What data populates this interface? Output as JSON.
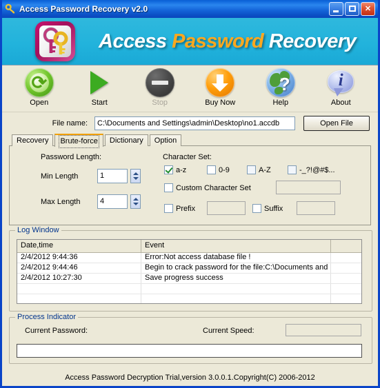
{
  "window": {
    "title": "Access Password Recovery v2.0",
    "icon": "key-icon",
    "controls": {
      "minimize": "minimize-button",
      "maximize": "maximize-button",
      "close": "close-button",
      "close_glyph": "✕"
    }
  },
  "banner": {
    "logo": "app-logo-key",
    "title_part1": "Access ",
    "title_part2": "Password ",
    "title_part3": "Recovery",
    "bg_color": "#22b3dc",
    "accent_color": "#ffa81e"
  },
  "toolbar": {
    "items": [
      {
        "label": "Open",
        "icon": "open-icon",
        "disabled": false
      },
      {
        "label": "Start",
        "icon": "start-icon",
        "disabled": false
      },
      {
        "label": "Stop",
        "icon": "stop-icon",
        "disabled": true
      },
      {
        "label": "Buy Now",
        "icon": "buy-now-icon",
        "disabled": false
      },
      {
        "label": "Help",
        "icon": "help-icon",
        "disabled": false
      },
      {
        "label": "About",
        "icon": "about-icon",
        "disabled": false
      }
    ]
  },
  "file_row": {
    "label": "File name:",
    "value": "C:\\Documents and Settings\\admin\\Desktop\\no1.accdb",
    "placeholder": "",
    "button_label": "Open File"
  },
  "tabs": [
    {
      "label": "Recovery",
      "active": false
    },
    {
      "label": "Brute-force",
      "active": true
    },
    {
      "label": "Dictionary",
      "active": false
    },
    {
      "label": "Option",
      "active": false
    }
  ],
  "brute_force": {
    "password_length_title": "Password Length:",
    "min_label": "Min Length",
    "min_value": "1",
    "max_label": "Max Length",
    "max_value": "4",
    "character_set_title": "Character Set:",
    "charsets": [
      {
        "label": "a-z",
        "checked": true
      },
      {
        "label": "0-9",
        "checked": false
      },
      {
        "label": "A-Z",
        "checked": false
      },
      {
        "label": "-_?!@#$...",
        "checked": false
      }
    ],
    "custom_label": "Custom Character Set",
    "custom_checked": false,
    "custom_value": "",
    "prefix_label": "Prefix",
    "prefix_checked": false,
    "prefix_value": "",
    "suffix_label": "Suffix",
    "suffix_checked": false,
    "suffix_value": ""
  },
  "log_window": {
    "title": "Log Window",
    "columns": [
      "Date,time",
      "Event",
      ""
    ],
    "rows": [
      [
        "2/4/2012 9:44:36",
        "Error:Not access database file !",
        ""
      ],
      [
        "2/4/2012 9:44:46",
        "Begin to crack password for the file:C:\\Documents and ...",
        ""
      ],
      [
        "2/4/2012 10:27:30",
        "Save progress success",
        ""
      ],
      [
        "",
        "",
        ""
      ],
      [
        "",
        "",
        ""
      ],
      [
        "",
        "",
        ""
      ],
      [
        "",
        "",
        ""
      ]
    ]
  },
  "process_indicator": {
    "title": "Process Indicator",
    "current_password_label": "Current Password:",
    "current_password_value": "",
    "current_speed_label": "Current Speed:",
    "current_speed_value": "",
    "progress_percent": 0
  },
  "footer": {
    "text": "Access Password Decryption Trial,version 3.0.0.1.Copyright(C) 2006-2012"
  }
}
